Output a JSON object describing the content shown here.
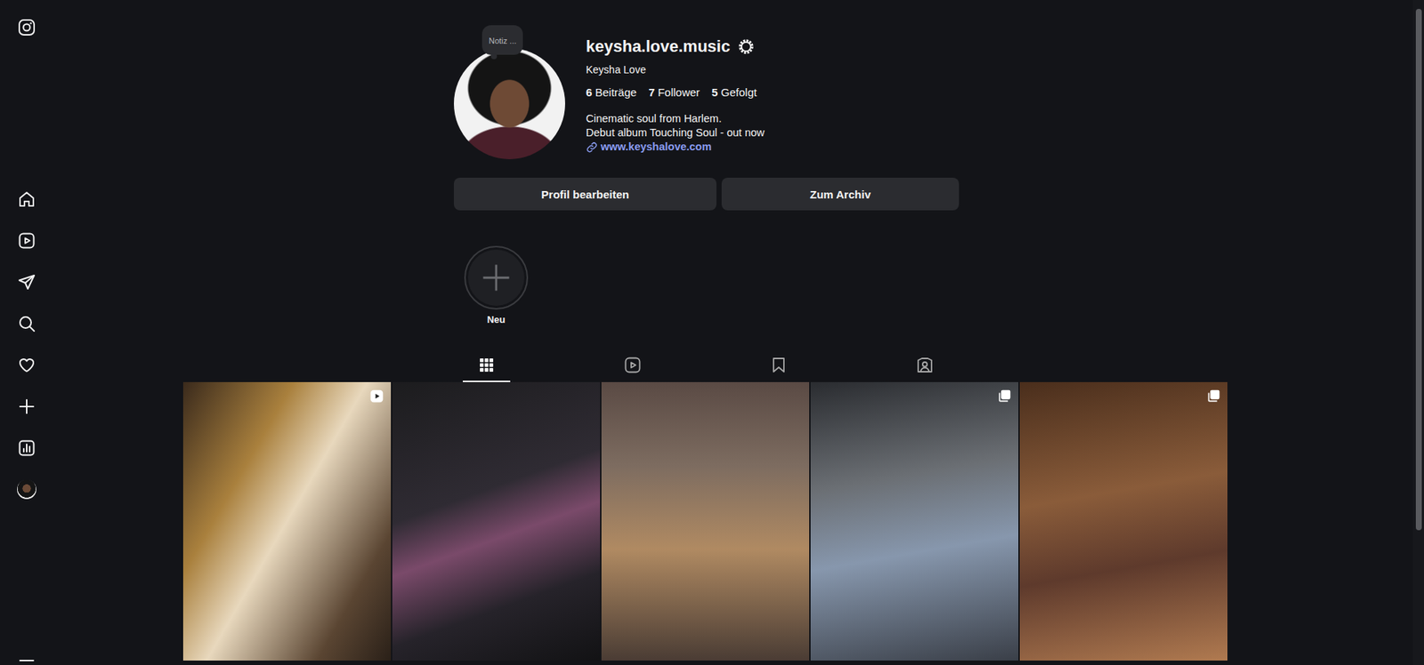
{
  "note": "Notiz ...",
  "profile": {
    "username": "keysha.love.music",
    "full_name": "Keysha Love",
    "stats": [
      {
        "count": "6",
        "label": "Beiträge"
      },
      {
        "count": "7",
        "label": "Follower"
      },
      {
        "count": "5",
        "label": "Gefolgt"
      }
    ],
    "bio": [
      "Cinematic soul from Harlem.",
      "Debut album Touching Soul - out now"
    ],
    "link": "www.keyshalove.com"
  },
  "buttons": [
    "Profil bearbeiten",
    "Zum Archiv"
  ],
  "highlights": [
    {
      "label": "Neu"
    }
  ],
  "tabs": [
    {
      "kind": "posts",
      "selected": true
    },
    {
      "kind": "reels",
      "selected": false
    },
    {
      "kind": "saved",
      "selected": false
    },
    {
      "kind": "tagged",
      "selected": false
    }
  ],
  "posts": [
    {
      "kind": "reel"
    },
    {
      "kind": "single"
    },
    {
      "kind": "single"
    },
    {
      "kind": "carousel"
    },
    {
      "kind": "carousel"
    }
  ]
}
